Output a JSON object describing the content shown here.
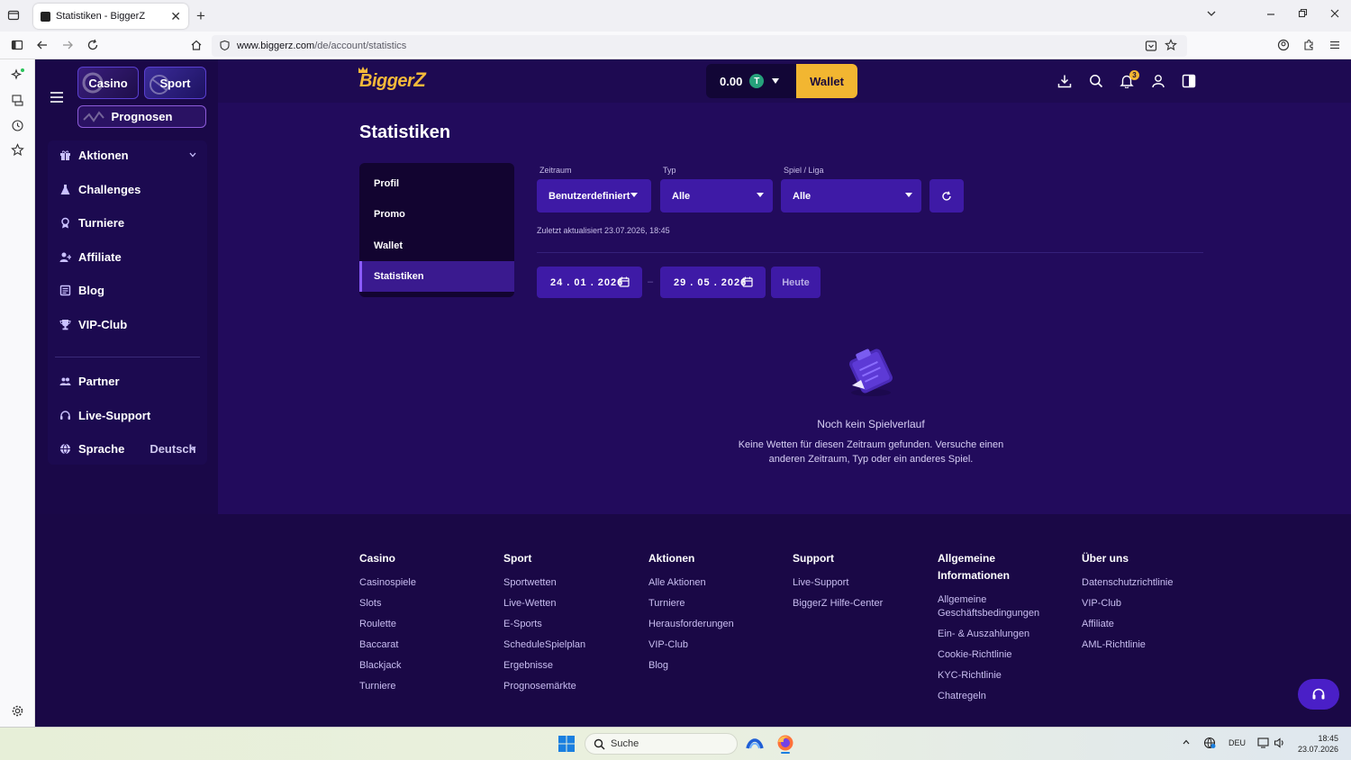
{
  "browser": {
    "tab_title": "Statistiken - BiggerZ",
    "url_host": "www.biggerz.com",
    "url_path": "/de/account/statistics"
  },
  "sidebar": {
    "casino_label": "Casino",
    "sport_label": "Sport",
    "prognosen_label": "Prognosen",
    "items": [
      {
        "label": "Aktionen",
        "icon": "gift-icon"
      },
      {
        "label": "Challenges",
        "icon": "flask-icon"
      },
      {
        "label": "Turniere",
        "icon": "medal-icon"
      },
      {
        "label": "Affiliate",
        "icon": "user-plus-icon"
      },
      {
        "label": "Blog",
        "icon": "newspaper-icon"
      },
      {
        "label": "VIP-Club",
        "icon": "trophy-icon"
      },
      {
        "label": "Partner",
        "icon": "users-icon"
      },
      {
        "label": "Live-Support",
        "icon": "headset-icon"
      },
      {
        "label": "Sprache",
        "icon": "globe-icon"
      }
    ],
    "language_value": "Deutsch"
  },
  "header": {
    "logo_text": "Bigger",
    "logo_z": "Z",
    "balance": "0.00",
    "currency_symbol": "T",
    "wallet_label": "Wallet",
    "notification_count": "3"
  },
  "page": {
    "title": "Statistiken",
    "account_nav": [
      "Profil",
      "Promo",
      "Wallet",
      "Statistiken"
    ],
    "filters": {
      "zeitraum_label": "Zeitraum",
      "zeitraum_value": "Benutzerdefiniert",
      "typ_label": "Typ",
      "typ_value": "Alle",
      "spiel_label": "Spiel / Liga",
      "spiel_value": "Alle"
    },
    "updated": "Zuletzt aktualisiert 23.07.2026, 18:45",
    "date_from": "24 . 01 . 2026",
    "date_to": "29 . 05 . 2026",
    "date_separator": "–",
    "heute_label": "Heute",
    "empty_title": "Noch kein Spielverlauf",
    "empty_desc": "Keine Wetten für diesen Zeitraum gefunden. Versuche einen anderen Zeitraum, Typ oder ein anderes Spiel."
  },
  "footer": {
    "columns": [
      {
        "heading": "Casino",
        "links": [
          "Casinospiele",
          "Slots",
          "Roulette",
          "Baccarat",
          "Blackjack",
          "Turniere"
        ]
      },
      {
        "heading": "Sport",
        "links": [
          "Sportwetten",
          "Live-Wetten",
          "E-Sports",
          "ScheduleSpielplan",
          "Ergebnisse",
          "Prognosemärkte"
        ]
      },
      {
        "heading": "Aktionen",
        "links": [
          "Alle Aktionen",
          "Turniere",
          "Herausforderungen",
          "VIP-Club",
          "Blog"
        ]
      },
      {
        "heading": "Support",
        "links": [
          "Live-Support",
          "BiggerZ Hilfe-Center"
        ]
      },
      {
        "heading": "Allgemeine Informationen",
        "links": [
          "Allgemeine Geschäftsbedingungen",
          "Ein- & Auszahlungen",
          "Cookie-Richtlinie",
          "KYC-Richtlinie",
          "Chatregeln"
        ]
      },
      {
        "heading": "Über uns",
        "links": [
          "Datenschutzrichtlinie",
          "VIP-Club",
          "Affiliate",
          "AML-Richtlinie"
        ]
      }
    ]
  },
  "taskbar": {
    "search_placeholder": "Suche",
    "language": "DEU",
    "time": "18:45",
    "date": "23.07.2026"
  },
  "colors": {
    "accent": "#3e1aa6",
    "wallet": "#f2b631",
    "background": "#220b5c"
  }
}
